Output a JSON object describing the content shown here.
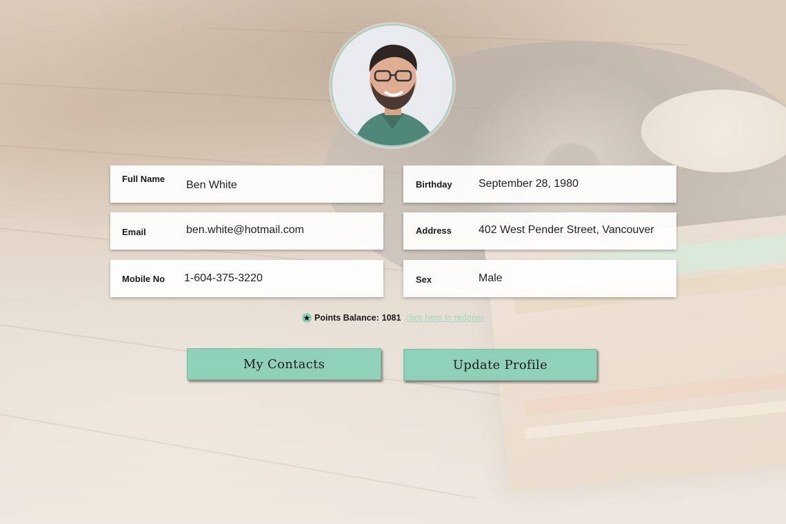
{
  "profile": {
    "avatar_icon": "profile-photo",
    "fields": {
      "full_name": {
        "label": "Full Name",
        "value": "Ben White"
      },
      "birthday": {
        "label": "Birthday",
        "value": "September 28, 1980"
      },
      "email": {
        "label": "Email",
        "value": "ben.white@hotmail.com"
      },
      "address": {
        "label": "Address",
        "value": "402 West Pender Street, Vancouver"
      },
      "mobile": {
        "label": "Mobile No",
        "value": "1-604-375-3220"
      },
      "sex": {
        "label": "Sex",
        "value": "Male"
      }
    }
  },
  "points": {
    "icon": "star-icon",
    "label": "Points Balance:",
    "value": "1081",
    "redeem_link": "click here to redeem"
  },
  "buttons": {
    "contacts_label": "My Contacts",
    "update_label": "Update Profile"
  },
  "colors": {
    "accent": "#8ed0b8",
    "link": "#9fd8c4",
    "avatar_border": "#9fd3bf"
  }
}
